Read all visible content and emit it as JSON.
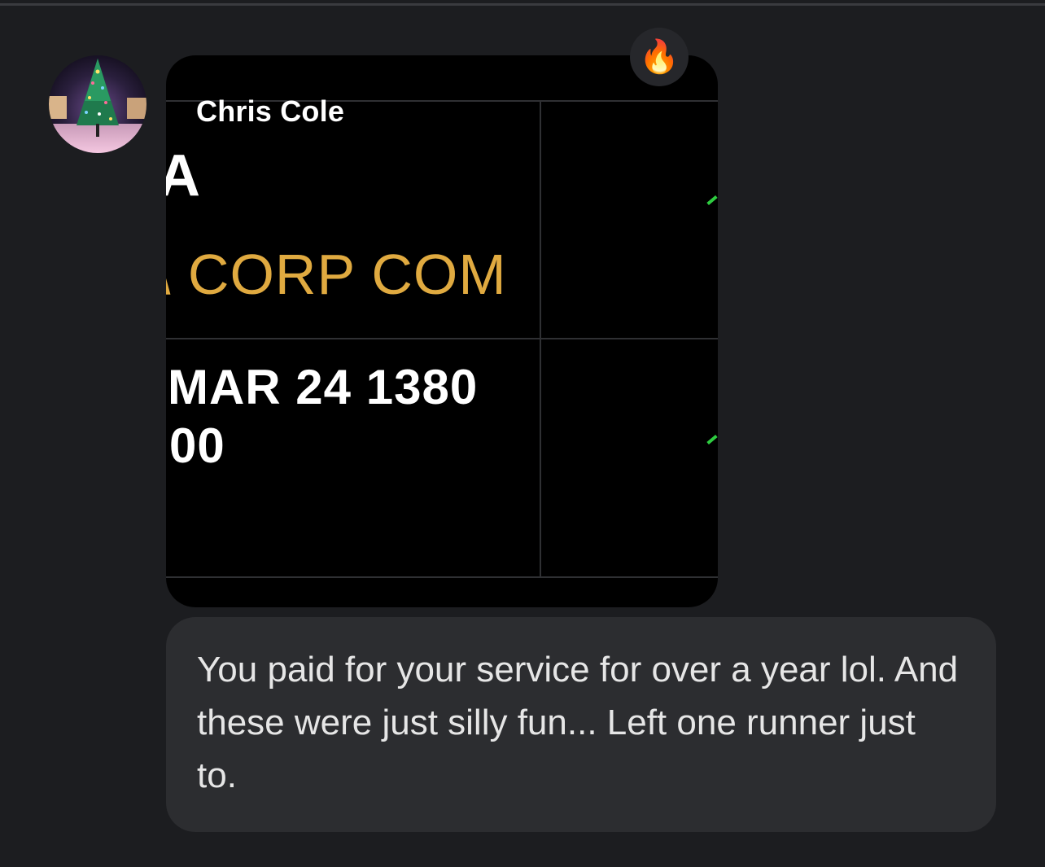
{
  "conversation": {
    "sender_name": "Chris Cole",
    "image_message": {
      "text_a": "A",
      "text_corp": "\\ CORP COM",
      "text_date": "MAR 24 1380",
      "text_price": "00"
    },
    "reaction": "🔥",
    "text_message": "You paid for your service for over a year lol. And these were just silly fun... Left one runner just to."
  },
  "colors": {
    "background": "#1c1d20",
    "bubble": "#2c2d30",
    "ticker_gold": "#e0aa40",
    "tick_green": "#2ecc40"
  },
  "icons": {
    "reaction": "fire-emoji",
    "avatar": "christmas-tree-photo"
  }
}
